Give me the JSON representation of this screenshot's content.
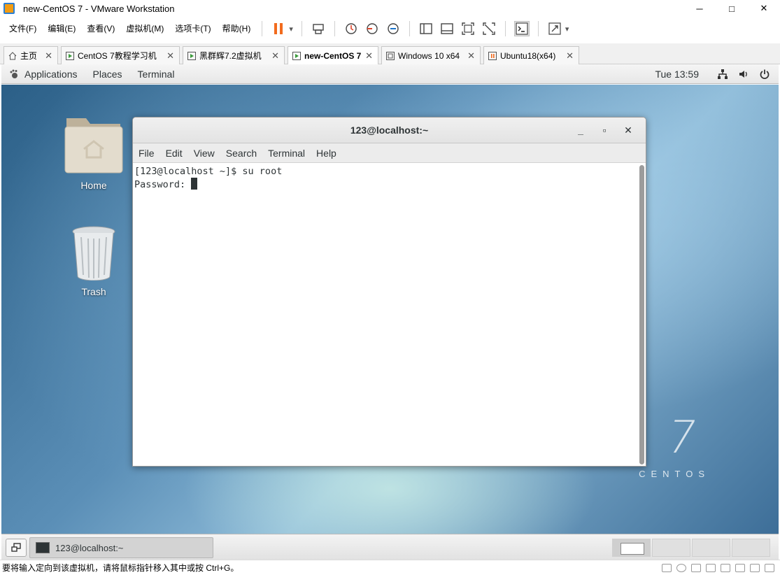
{
  "window": {
    "title": "new-CentOS 7 - VMware Workstation",
    "minimize": "─",
    "maximize": "□",
    "close": "✕"
  },
  "menubar": {
    "items": [
      "文件(F)",
      "编辑(E)",
      "查看(V)",
      "虚拟机(M)",
      "选项卡(T)",
      "帮助(H)"
    ]
  },
  "toolbar": {
    "pause_icon": "pause-icon",
    "dropdown": "▾",
    "accent_color": "#f26b1d"
  },
  "tabs": [
    {
      "label": "主页",
      "close": "✕"
    },
    {
      "label": "CentOS 7教程学习机",
      "close": "✕"
    },
    {
      "label": "黑群辉7.2虚拟机",
      "close": "✕"
    },
    {
      "label": "new-CentOS 7",
      "close": "✕"
    },
    {
      "label": "Windows 10 x64",
      "close": "✕"
    },
    {
      "label": "Ubuntu18(x64)",
      "close": "✕"
    }
  ],
  "guest_panel": {
    "applications": "Applications",
    "places": "Places",
    "terminal": "Terminal",
    "clock": "Tue 13:59"
  },
  "desktop": {
    "home_label": "Home",
    "trash_label": "Trash",
    "brand_number": "7",
    "brand_word": "CENTOS"
  },
  "terminal": {
    "title": "123@localhost:~",
    "min": "_",
    "max": "▫",
    "close": "✕",
    "menu": [
      "File",
      "Edit",
      "View",
      "Search",
      "Terminal",
      "Help"
    ],
    "lines": [
      "[123@localhost ~]$ su root",
      "Password: "
    ]
  },
  "bottom_panel": {
    "task_label": "123@localhost:~"
  },
  "statusbar": {
    "text": "要将输入定向到该虚拟机，请将鼠标指针移入其中或按 Ctrl+G。"
  }
}
